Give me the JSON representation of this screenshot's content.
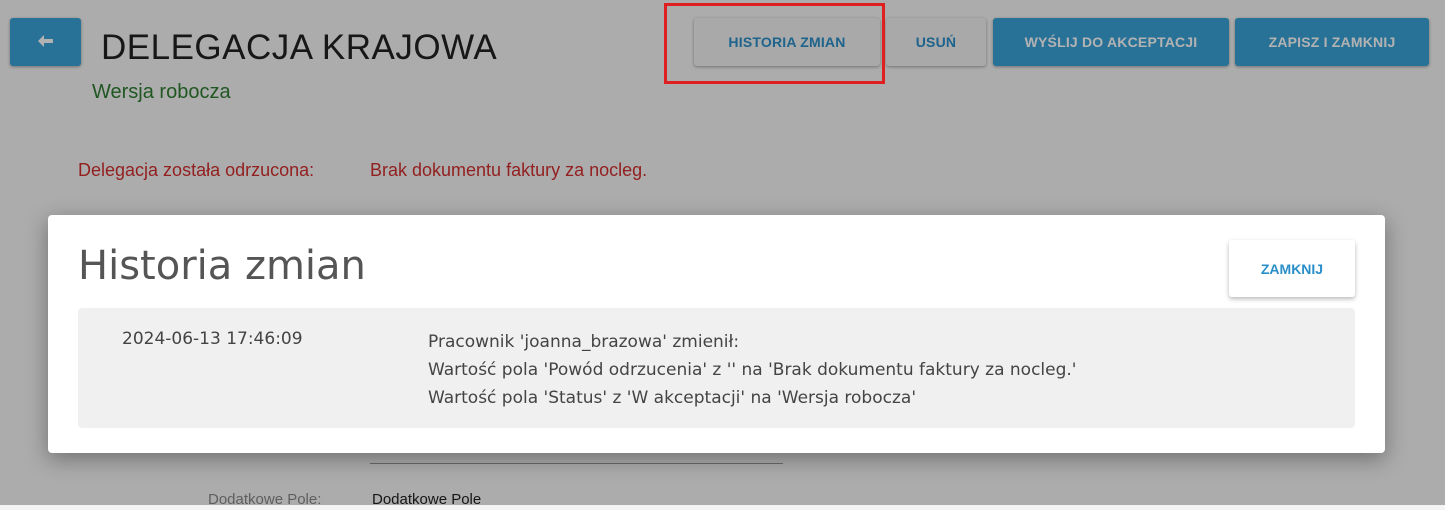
{
  "header": {
    "title": "DELEGACJA KRAJOWA",
    "subtitle": "Wersja robocza",
    "back_icon": "arrow-left-icon"
  },
  "toolbar": {
    "history_label": "HISTORIA ZMIAN",
    "delete_label": "USUŃ",
    "send_label": "WYŚLIJ DO AKCEPTACJI",
    "save_close_label": "ZAPISZ I ZAMKNIJ"
  },
  "rejection": {
    "label": "Delegacja została odrzucona:",
    "reason": "Brak dokumentu faktury za nocleg."
  },
  "form": {
    "extra_field_label": "Dodatkowe Pole:",
    "extra_field_value": "Dodatkowe Pole"
  },
  "modal": {
    "title": "Historia zmian",
    "close_label": "ZAMKNIJ",
    "entries": [
      {
        "date": "2024-06-13 17:46:09",
        "lines": [
          "Pracownik 'joanna_brazowa' zmienił:",
          "Wartość pola 'Powód odrzucenia' z '' na 'Brak dokumentu faktury za nocleg.'",
          "Wartość pola 'Status' z 'W akceptacji' na 'Wersja robocza'"
        ]
      }
    ]
  },
  "colors": {
    "primary": "#3aa3d8",
    "link": "#2a8fc9",
    "error": "#d32f2f",
    "status": "#2e7d32",
    "highlight": "#e02020"
  }
}
